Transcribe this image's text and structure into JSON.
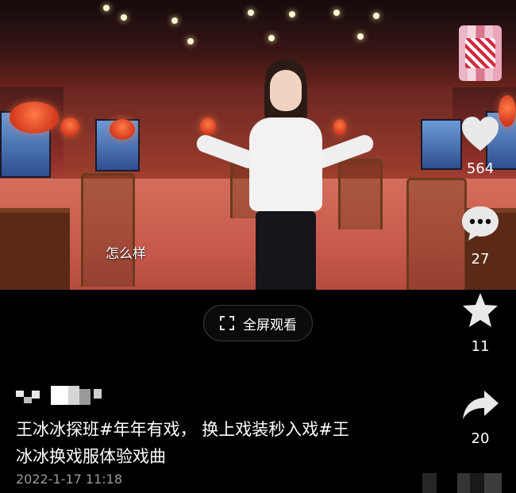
{
  "video": {
    "subtitle": "怎么样"
  },
  "fullscreen": {
    "label": "全屏观看",
    "icon": "fullscreen-icon"
  },
  "rail": {
    "avatar_icon": "avatar",
    "like": {
      "icon": "heart-icon",
      "count": "564"
    },
    "comment": {
      "icon": "comment-icon",
      "count": "27"
    },
    "favorite": {
      "icon": "star-icon",
      "count": "11"
    },
    "share": {
      "icon": "share-icon",
      "count": "20"
    }
  },
  "post": {
    "caption_line1": "王冰冰探班#年年有戏， 换上戏装秒入戏#王",
    "caption_line2": "冰冰换戏服体验戏曲",
    "date": "2022-1-17 11:18"
  },
  "colors": {
    "background": "#000000",
    "text": "#ffffff",
    "muted": "#9a9a9a",
    "pill_border": "#3a3a3a"
  }
}
